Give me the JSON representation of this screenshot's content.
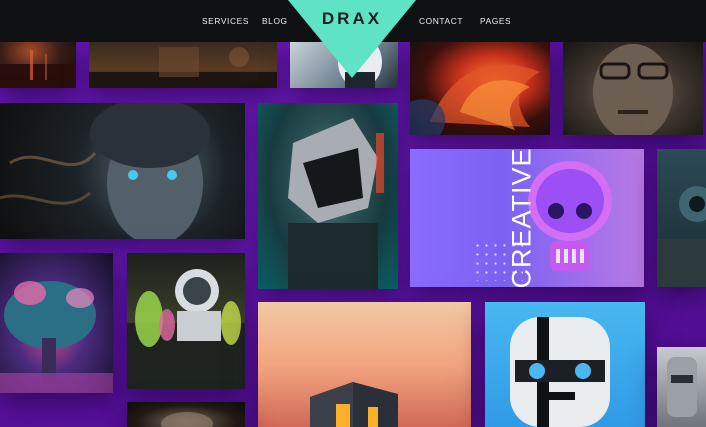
{
  "nav": {
    "links": [
      "SERVICES",
      "BLOG",
      "CONTACT",
      "PAGES"
    ],
    "logo": "DRAX",
    "logo_color": "#5ee3c4",
    "background": "#0f1113"
  },
  "gallery": {
    "accent_background": "#6a17b8",
    "creative_tile": {
      "word": "CREATIVE"
    },
    "tiles": [
      "cityscape-red-tile",
      "warm-room-tile",
      "white-robot-tile",
      "fiery-abstract-tile",
      "old-man-portrait-tile",
      "cyborg-woman-tile",
      "helmet-robot-tile",
      "creative-skull-tile",
      "teal-creature-tile",
      "fantasy-tree-tile",
      "astronaut-garden-tile",
      "sunset-cube-tile",
      "robot-face-tile",
      "grey-robot-tile",
      "dark-figure-tile"
    ]
  }
}
